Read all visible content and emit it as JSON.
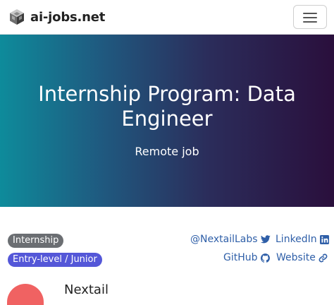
{
  "navbar": {
    "brand": "ai-jobs.net",
    "logo_icon": "ai-jobs-cube-logo",
    "menu_icon": "hamburger-menu-icon"
  },
  "hero": {
    "title": "Internship Program: Data Engineer",
    "subtitle": "Remote job",
    "gradient_colors": [
      "#0e8b9b",
      "#2b2d5b",
      "#2a0f3c"
    ]
  },
  "badges": [
    {
      "label": "Internship",
      "color": "#6b6e72"
    },
    {
      "label": "Entry-level / Junior",
      "color": "#5457d8"
    }
  ],
  "links": {
    "twitter": {
      "label": "@NextailLabs",
      "icon": "twitter-icon"
    },
    "linkedin": {
      "label": "LinkedIn",
      "icon": "linkedin-icon"
    },
    "github": {
      "label": "GitHub",
      "icon": "github-icon"
    },
    "website": {
      "label": "Website",
      "icon": "link-icon"
    },
    "link_color": "#2f5fa8"
  },
  "company": {
    "name": "Nextail",
    "logo_color": "#f06262"
  }
}
